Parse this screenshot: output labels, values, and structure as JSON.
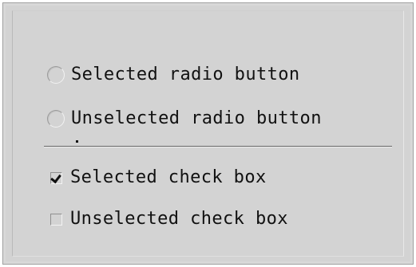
{
  "options": {
    "radio_selected": {
      "label": "Selected radio button",
      "checked": true
    },
    "radio_unselected": {
      "label": "Unselected radio button",
      "checked": false
    },
    "checkbox_selected": {
      "label": "Selected check box",
      "checked": true
    },
    "checkbox_unselected": {
      "label": "Unselected check box",
      "checked": false
    }
  },
  "colors": {
    "background": "#d3d3d3",
    "text": "#111111",
    "separator": "#666666"
  }
}
